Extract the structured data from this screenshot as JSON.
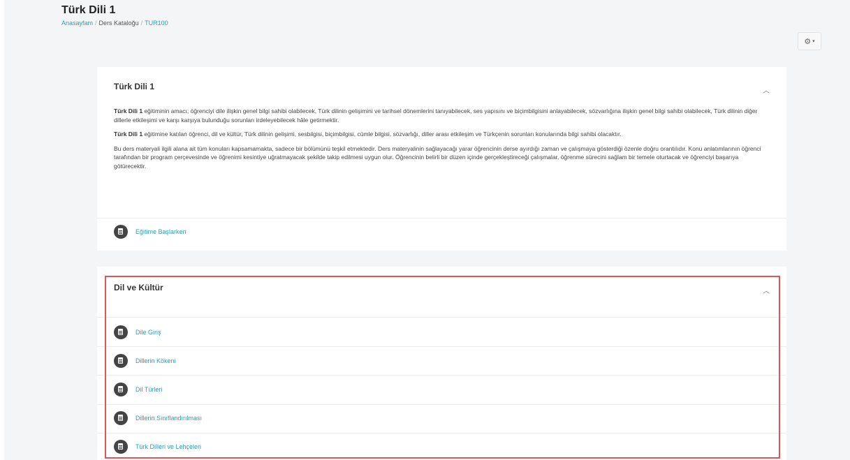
{
  "header": {
    "title": "Türk Dili 1",
    "breadcrumb": [
      "Anasayfam",
      "Ders Kataloğu",
      "TUR100"
    ]
  },
  "settings": {
    "icon": "gear-icon",
    "caret": "▾"
  },
  "section1": {
    "title": "Türk Dili 1",
    "collapse_icon": "chevron-up-icon",
    "summary": [
      {
        "bold": "Türk Dili 1",
        "text": " eğitiminin amacı; öğrenciyi dile ilişkin genel bilgi sahibi olabilecek, Türk dilinin gelişimini ve tarihsel dönemlerini tanıyabilecek, ses yapısını ve biçimbilgisini anlayabilecek, sözvarlığına ilişkin genel bilgi sahibi olabilecek, Türk dilinin diğer dillerle etkileşimi ve karşı karşıya bulunduğu sorunları irdeleyebilecek hâle getirmektir."
      },
      {
        "bold": "Türk Dili 1",
        "text": " eğitimine katılan öğrenci, dil ve kültür, Türk dilinin gelişimi, sesbilgisi, biçimbilgisi, cümle bilgisi, sözvarlığı, diller arası etkileşim ve Türkçenin sorunları konularında bilgi sahibi olacaktır."
      },
      {
        "bold": "",
        "text": "Bu ders materyali ilgili alana ait tüm konuları kapsamamakta, sadece bir bölümünü teşkil etmektedir. Ders materyalinin sağlayacağı yarar öğrencinin derse ayırdığı zaman ve çalışmaya gösterdiği özenle doğru orantılıdır. Konu anlatımlarının öğrenci tarafından bir program çerçevesinde ve öğrenimi kesintiye uğratmayacak şekilde takip edilmesi uygun olur. Öğrencinin belirli bir düzen içinde gerçekleştireceği çalışmalar, öğrenme sürecini sağlam bir temele oturtacak ve öğrenciyi başarıya götürecektir."
      }
    ],
    "activities": [
      "Eğitime Başlarken"
    ]
  },
  "section2": {
    "title": "Dil ve Kültür",
    "collapse_icon": "chevron-up-icon",
    "activities": [
      "Dile Giriş",
      "Dillerin Kökeni",
      "Dil Türleri",
      "Dillerin Sınıflandırılması",
      "Türk Dilleri ve Lehçeleri"
    ]
  },
  "colors": {
    "link": "#2a9fb0",
    "highlight": "#e05555"
  }
}
